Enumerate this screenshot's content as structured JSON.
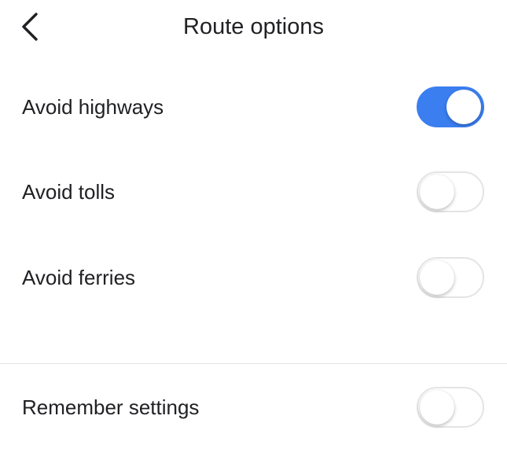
{
  "header": {
    "title": "Route options",
    "back_icon": "chevron-left-icon"
  },
  "options": [
    {
      "label": "Avoid highways",
      "enabled": true
    },
    {
      "label": "Avoid tolls",
      "enabled": false
    },
    {
      "label": "Avoid ferries",
      "enabled": false
    }
  ],
  "remember": {
    "label": "Remember settings",
    "enabled": false
  },
  "colors": {
    "toggle_on": "#3a7ef0",
    "toggle_off_border": "#e4e4e4",
    "text": "#202124",
    "divider": "#e3e3e3"
  }
}
